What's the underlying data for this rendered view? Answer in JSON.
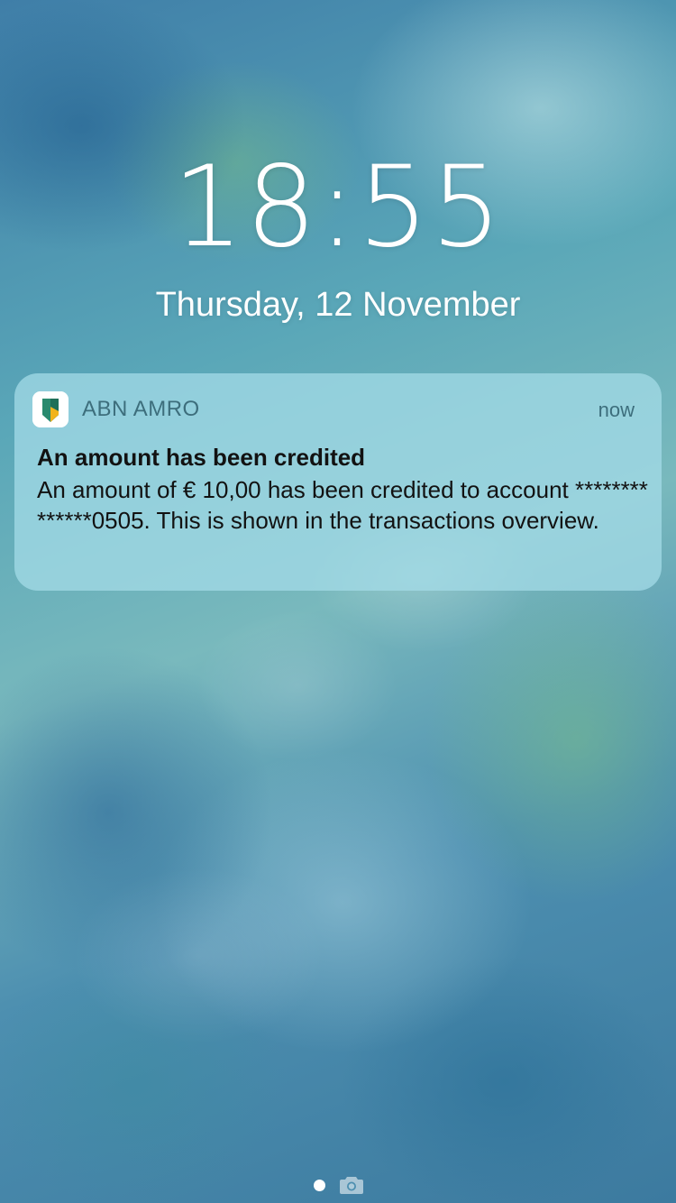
{
  "lock_screen": {
    "time": "18:55",
    "date": "Thursday, 12 November"
  },
  "notification": {
    "app_name": "ABN AMRO",
    "app_icon": "abn-amro-shield-icon",
    "timestamp": "now",
    "title": "An amount has been credited",
    "body": "An amount of € 10,00 has been credited to account **************0505. This is shown in the transactions overview."
  },
  "bottom_bar": {
    "page_indicator_icon": "page-dot-icon",
    "camera_icon": "camera-icon"
  },
  "colors": {
    "notification_background": "#a5dce8",
    "app_name_color": "#3d6e7c",
    "icon_green": "#2a8a6e",
    "icon_yellow": "#f2b31c"
  }
}
